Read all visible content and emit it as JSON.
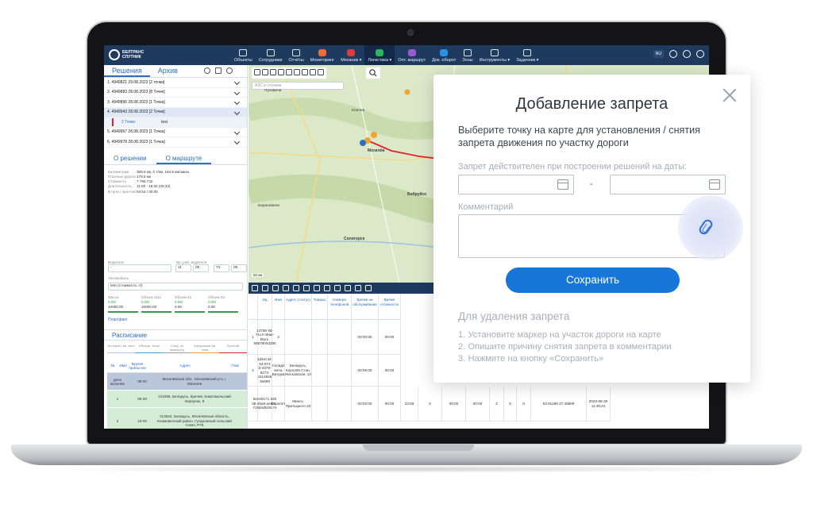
{
  "app": {
    "brand": "БЕЛТРАНС СПУТНИК",
    "nav": [
      {
        "label": "Объекты",
        "color": ""
      },
      {
        "label": "Сотрудники",
        "color": ""
      },
      {
        "label": "Отчёты",
        "color": ""
      },
      {
        "label": "Мониторинг",
        "color": "#f26b3a"
      },
      {
        "label": "Механик ▾",
        "color": "#e03a3a"
      },
      {
        "label": "Логистика ▾",
        "color": "#2bb55e"
      },
      {
        "label": "Опт. маршрут",
        "color": "#9b59d0"
      },
      {
        "label": "Док. оборот",
        "color": "#2c8fe0"
      },
      {
        "label": "Зоны",
        "color": ""
      },
      {
        "label": "Инструменты ▾",
        "color": ""
      },
      {
        "label": "Задачник ▾",
        "color": ""
      }
    ],
    "lang": "RU"
  },
  "left": {
    "tab_solutions": "Решения",
    "tab_archive": "Архив",
    "solutions": [
      "1. 4949821 29.08.2023 [2 точки]",
      "2. 4949883 28.08.2023 [8 Точек]",
      "3. 4949896 28.08.2023 [1 Точка]",
      "4. 4949943 28.08.2023 [2 Точки]",
      "5. 4949967 28.08.2023 [1 Точка]",
      "6. 4949978 28.08.2023 [1 Точка]"
    ],
    "selected_sub": {
      "points": "2 Точки",
      "name": "test"
    },
    "subtab_solution": "О решении",
    "subtab_route": "О маршруте",
    "route_info": [
      {
        "k": "Километраж",
        "v": "369.6 км, 0 т/км, 184.8 км/заказ"
      },
      {
        "k": "Платные дороги",
        "v": "179.5 км"
      },
      {
        "k": "Стоимость",
        "v": "7 795.742"
      },
      {
        "k": "Длительность",
        "v": "11:00 - 16:34 (05:34)"
      },
      {
        "k": "В пути / простой",
        "v": "04:54 / 00:00"
      }
    ],
    "driver_label": "Водитель",
    "work_time_label": "Вр. раб. водителя",
    "driver_value": "-",
    "work_time_values": [
      "11",
      "00",
      "72",
      "00"
    ],
    "vehicle_label": "Автомобиль",
    "vehicle_value": "test (стоимость: 0)",
    "mass": [
      {
        "t": "Масса",
        "a": "0.00/",
        "b": "10000.00"
      },
      {
        "t": "Объем 1111",
        "a": "0.00/",
        "b": "10000.00"
      },
      {
        "t": "Объем 22",
        "a": "0.00/",
        "b": "0.00"
      },
      {
        "t": "Объем 33",
        "a": "0.00/",
        "b": "0.00"
      }
    ],
    "plan_fact": "План\\факт",
    "schedule_title": "Расписание",
    "legend": [
      "На научн. вр. окно",
      "Обслуж. точку",
      "След. по маршруту",
      "Нарушение вр. окна",
      "Простой"
    ],
    "sched_cols": [
      "№",
      "Имя",
      "Время прибытия",
      "Адрес",
      "Пом"
    ],
    "sched_rows": [
      {
        "n": "депо могилев",
        "time": "08:00",
        "addr": "Могилёвская обл., Могилёвский р-н, г. Могилев"
      },
      {
        "n": "1",
        "time": "09:39",
        "addr": "213495, Беларусь, Кричев, Комсомольский переулок, 9"
      },
      {
        "n": "2",
        "time": "10:09",
        "addr": "213634, Беларусь, Могилёвская область, Климовичский район, Гусаровский сельский Совет, Р75"
      },
      {
        "n": "",
        "time": "",
        "addr": "213621, Беларусь, Могилёвская область,"
      }
    ]
  },
  "map": {
    "search_placeholder": "АЗС и стоянки",
    "places": [
      {
        "t": "Кличев",
        "b": false
      },
      {
        "t": "Пуховичи",
        "b": false
      },
      {
        "t": "Могилёв",
        "b": true
      },
      {
        "t": "Барановичи",
        "b": false
      },
      {
        "t": "Бобруйск",
        "b": true
      },
      {
        "t": "Мстиславль",
        "b": false
      },
      {
        "t": "Солигорск",
        "b": true
      },
      {
        "t": "Гомель",
        "b": false
      }
    ],
    "scale": "50 км"
  },
  "grid": {
    "cols": [
      "Ид",
      "Имя",
      "Адрес (статус)",
      "Товары",
      "Номера телефонов",
      "Время на обслуживание",
      "Время готовности"
    ],
    "rows": [
      {
        "id": "13788 9d-71c4-49ae-b5e1-56879b0d290",
        "name": "3",
        "addr": "",
        "srv": "00:00:00",
        "ready": "00:00"
      },
      {
        "id": "1d2ec44-62-574 b-4378-8273-c514845 3e699",
        "name": "Складо мета Витрум",
        "addr": "Беларусь, Королёв Стан, Московская, 10",
        "srv": "00:05:00",
        "ready": "00:00"
      },
      {
        "id": "5ec60171-320 5-45a9-ae82-7c9d4db20c7e",
        "name": "Евроопт",
        "addr": "Минск, Притыцкого 20",
        "srv": "00:02:00",
        "ready": "00:00"
      }
    ],
    "extra_values": [
      "23:59",
      "0",
      "00:00",
      "00:00",
      "2",
      "0",
      "0",
      "53.91258 27.49809",
      "2023-08-30 11:45:24"
    ]
  },
  "modal": {
    "title": "Добавление запрета",
    "description": "Выберите точку на карте для установления / снятия запрета движения по участку дороги",
    "dates_label": "Запрет действителен при построении решений на даты:",
    "dash": "-",
    "comment_label": "Комментарий",
    "save": "Сохранить",
    "hint_title": "Для удаления запрета",
    "hints": [
      "1. Установите маркер на участок дороги на карте",
      "2. Опишите причину снятия запрета в комментарии",
      "3. Нажмите на кнопку «Сохранить»"
    ]
  }
}
